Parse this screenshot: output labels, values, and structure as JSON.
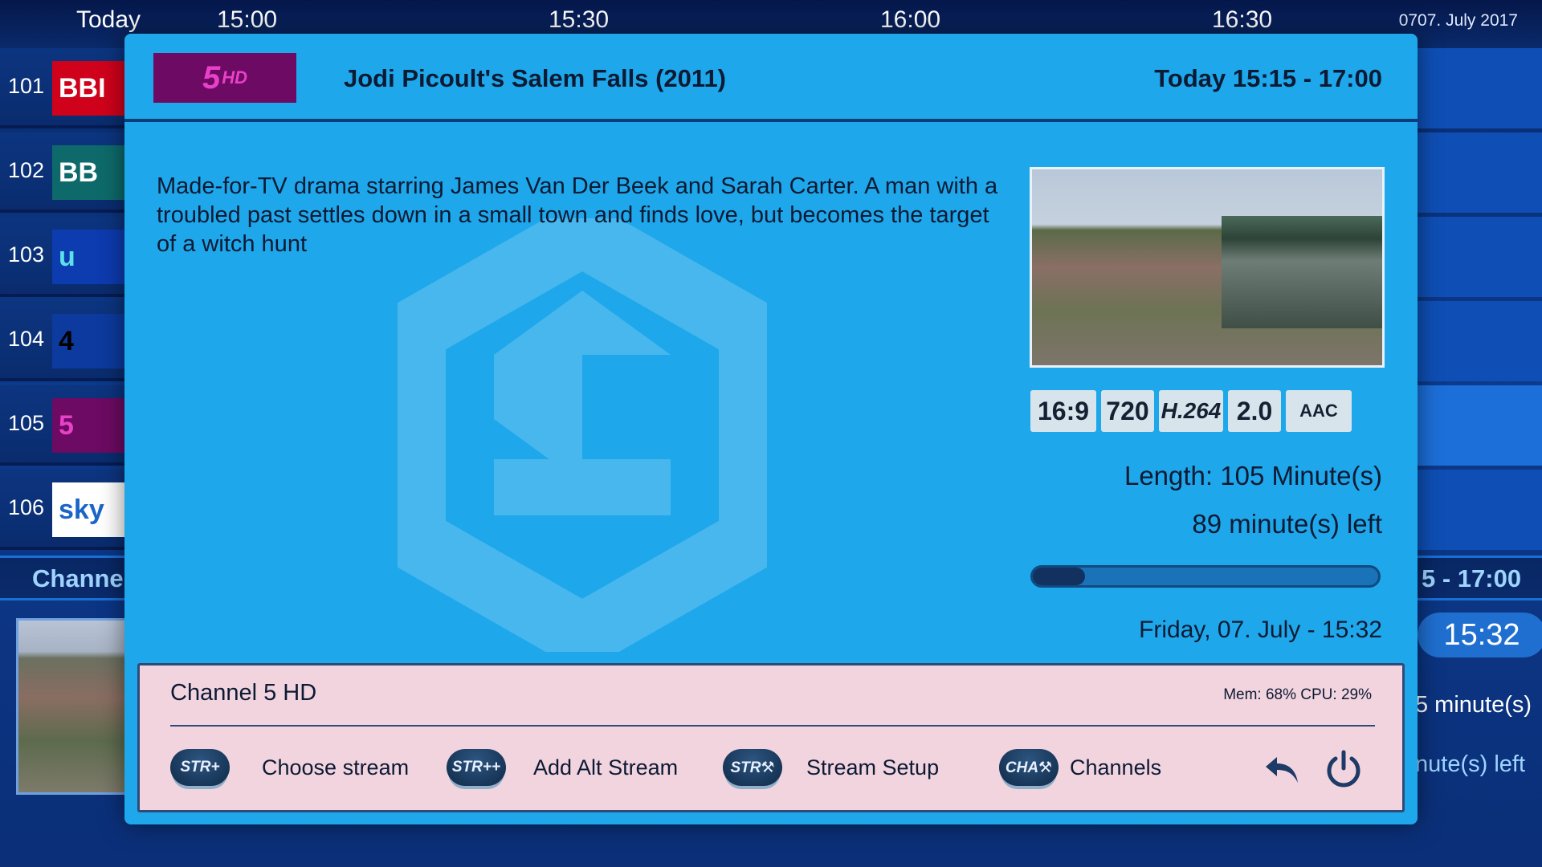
{
  "epg": {
    "today_label": "Today",
    "times": [
      "15:00",
      "15:30",
      "16:00",
      "16:30"
    ],
    "date": "0707. July 2017",
    "channels": [
      {
        "number": "101",
        "logo": "BBI",
        "logo_bg": "#d0021b",
        "logo_fg": "#ffffff"
      },
      {
        "number": "102",
        "logo": "BB",
        "logo_bg": "#0e6a6a",
        "logo_fg": "#ffffff"
      },
      {
        "number": "103",
        "logo": "u",
        "logo_bg": "#0d3bb0",
        "logo_fg": "#5ee0e8"
      },
      {
        "number": "104",
        "logo": "4",
        "logo_bg": "#0c3a9e",
        "logo_fg": "#000000"
      },
      {
        "number": "105",
        "logo": "5",
        "logo_bg": "#6d0a63",
        "logo_fg": "#e840c8"
      },
      {
        "number": "106",
        "logo": "sky",
        "logo_bg": "#ffffff",
        "logo_fg": "#1b64c8"
      }
    ],
    "channel_bar_label": "Channel",
    "channel_bar_right": "5 - 17:00",
    "clock": "15:32",
    "right_info_1": "5 minute(s)",
    "right_info_2": "nute(s) left"
  },
  "dialog": {
    "channel_logo_text": "5",
    "channel_logo_sup": "HD",
    "title": "Jodi Picoult's Salem Falls (2011)",
    "time_range": "Today 15:15 - 17:00",
    "description": "Made-for-TV drama starring James Van Der Beek and Sarah Carter. A man with a troubled past settles down in a small town and finds love, but becomes the target of a witch hunt",
    "badges": [
      "16:9",
      "720",
      "H.264",
      "2.0",
      "AAC"
    ],
    "length": "Length: 105 Minute(s)",
    "remaining": "89 minute(s) left",
    "progress_fraction": 0.15,
    "now": "Friday, 07. July  -  15:32"
  },
  "footer": {
    "channel_name": "Channel 5 HD",
    "stats": "Mem: 68%   CPU: 29%",
    "buttons": [
      {
        "icon": "STR+",
        "label": "Choose stream"
      },
      {
        "icon": "STR++",
        "label": "Add Alt Stream"
      },
      {
        "icon": "STR⚒",
        "label": "Stream Setup"
      },
      {
        "icon": "CHA⚒",
        "label": "Channels"
      }
    ]
  },
  "colors": {
    "dialog_bg": "#1ea8eb",
    "footer_bg": "#f2d4df",
    "text_dark": "#0d1a33",
    "accent": "#9fd4ff"
  }
}
